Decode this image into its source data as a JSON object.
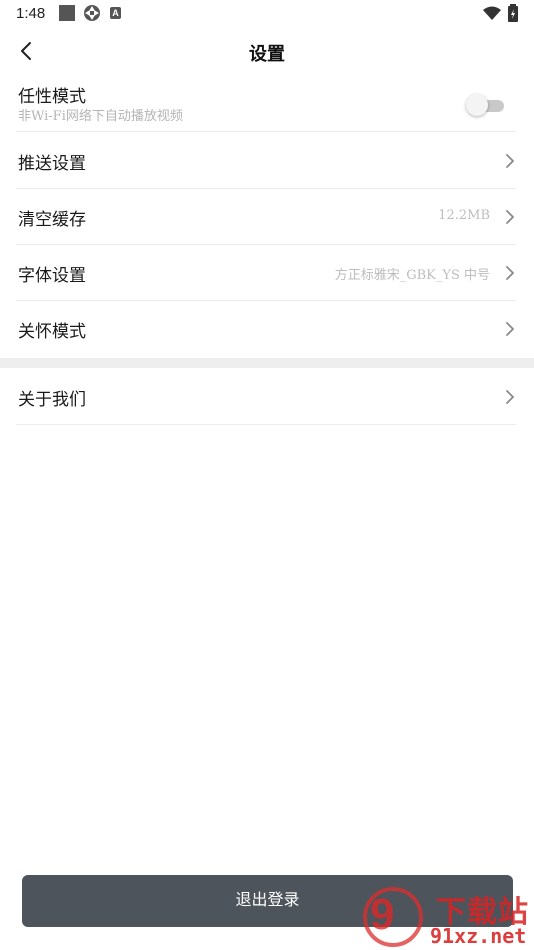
{
  "status_bar": {
    "time": "1:48",
    "icons": [
      "square-icon",
      "aperture-icon",
      "a-badge-icon",
      "wifi-icon",
      "battery-icon"
    ]
  },
  "header": {
    "title": "设置",
    "back_icon": "back-arrow-icon"
  },
  "settings": {
    "personal_mode": {
      "label": "任性模式",
      "subtitle": "非Wi-Fi网络下自动播放视频",
      "enabled": false
    },
    "push": {
      "label": "推送设置"
    },
    "cache": {
      "label": "清空缓存",
      "value": "12.2MB"
    },
    "font": {
      "label": "字体设置",
      "value": "方正标雅宋_GBK_YS 中号"
    },
    "care_mode": {
      "label": "关怀模式"
    },
    "about": {
      "label": "关于我们"
    }
  },
  "logout": {
    "label": "退出登录"
  },
  "watermark": {
    "big": "9",
    "cn": "下载站",
    "url": "91xz.net"
  },
  "colors": {
    "logout_bg": "#4d545c",
    "divider": "#ececec",
    "section_gap": "#eeeeee",
    "watermark": "#d82828"
  }
}
